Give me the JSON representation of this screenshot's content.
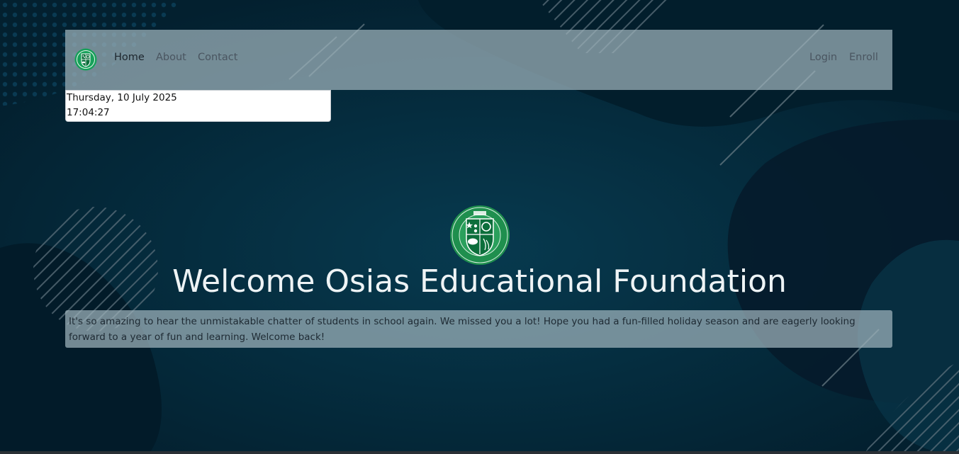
{
  "navbar": {
    "logo_alt": "Osias Educational Foundation logo",
    "links": [
      {
        "label": "Home",
        "active": true
      },
      {
        "label": "About",
        "active": false
      },
      {
        "label": "Contact",
        "active": false
      }
    ],
    "auth_links": [
      {
        "label": "Login"
      },
      {
        "label": "Enroll"
      }
    ]
  },
  "clock": {
    "date": "Thursday, 10 July 2025",
    "time": "17:04:27"
  },
  "hero": {
    "crest_icon": "school-crest-icon",
    "title": "Welcome Osias Educational Foundation",
    "message": "It's so amazing to hear the unmistakable chatter of students in school again. We missed you a lot! Hope you had a fun-filled holiday season and are eagerly looking forward to a year of fun and learning. Welcome back!"
  },
  "colors": {
    "background": "#04283a",
    "navbar_overlay": "#a0b4bc",
    "crest_green": "#1f8f4e",
    "title_text": "#eef3f5"
  }
}
